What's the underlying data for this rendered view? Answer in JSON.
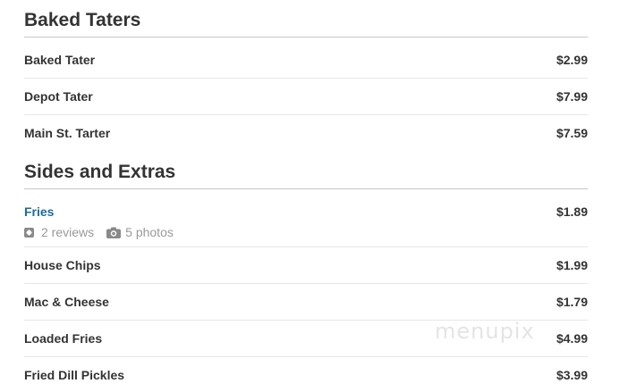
{
  "sections": [
    {
      "title": "Baked Taters",
      "items": [
        {
          "name": "Baked Tater",
          "price": "$2.99"
        },
        {
          "name": "Depot Tater",
          "price": "$7.99"
        },
        {
          "name": "Main St. Tarter",
          "price": "$7.59"
        }
      ]
    },
    {
      "title": "Sides and Extras",
      "items": [
        {
          "name": "Fries",
          "price": "$1.89",
          "reviews": "2 reviews",
          "photos": "5 photos"
        },
        {
          "name": "House Chips",
          "price": "$1.99"
        },
        {
          "name": "Mac & Cheese",
          "price": "$1.79"
        },
        {
          "name": "Loaded Fries",
          "price": "$4.99"
        },
        {
          "name": "Fried Dill Pickles",
          "price": "$3.99"
        }
      ]
    }
  ],
  "watermark": "menupix",
  "icons": {
    "review": "review-icon",
    "photo": "camera-icon"
  },
  "colors": {
    "link": "#1a6c9b",
    "text": "#333333",
    "muted": "#999999"
  }
}
